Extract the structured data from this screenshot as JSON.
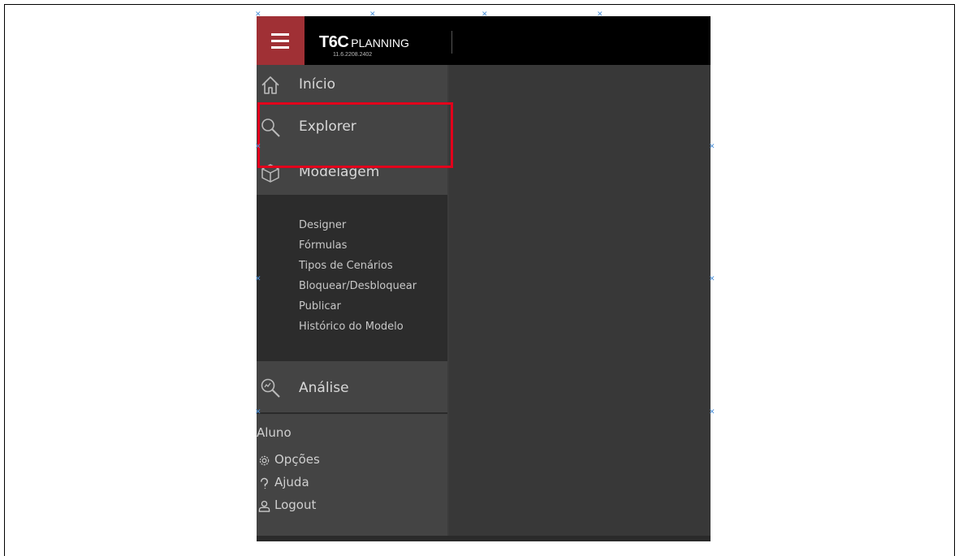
{
  "header": {
    "brand": "T6C",
    "product": "PLANNING",
    "version": "11.6.2208.2402"
  },
  "nav": {
    "items": [
      {
        "label": "Início",
        "icon": "home-icon"
      },
      {
        "label": "Explorer",
        "icon": "search-icon"
      },
      {
        "label": "Modelagem",
        "icon": "cube-icon"
      }
    ],
    "submenu": [
      "Designer",
      "Fórmulas",
      "Tipos de Cenários",
      "Bloquear/Desbloquear",
      "Publicar",
      "Histórico do Modelo"
    ],
    "analysis": {
      "label": "Análise",
      "icon": "analysis-search-icon"
    }
  },
  "user": {
    "name": "Aluno",
    "options": [
      {
        "label": "Opções",
        "icon": "gear-icon"
      },
      {
        "label": "Ajuda",
        "icon": "help-icon"
      },
      {
        "label": "Logout",
        "icon": "user-icon"
      }
    ]
  },
  "colors": {
    "topbar": "#000000",
    "menu_button": "#a03035",
    "sidebar": "#444444",
    "submenu": "#2c2c2c",
    "content": "#383838",
    "highlight": "#e3001b"
  }
}
